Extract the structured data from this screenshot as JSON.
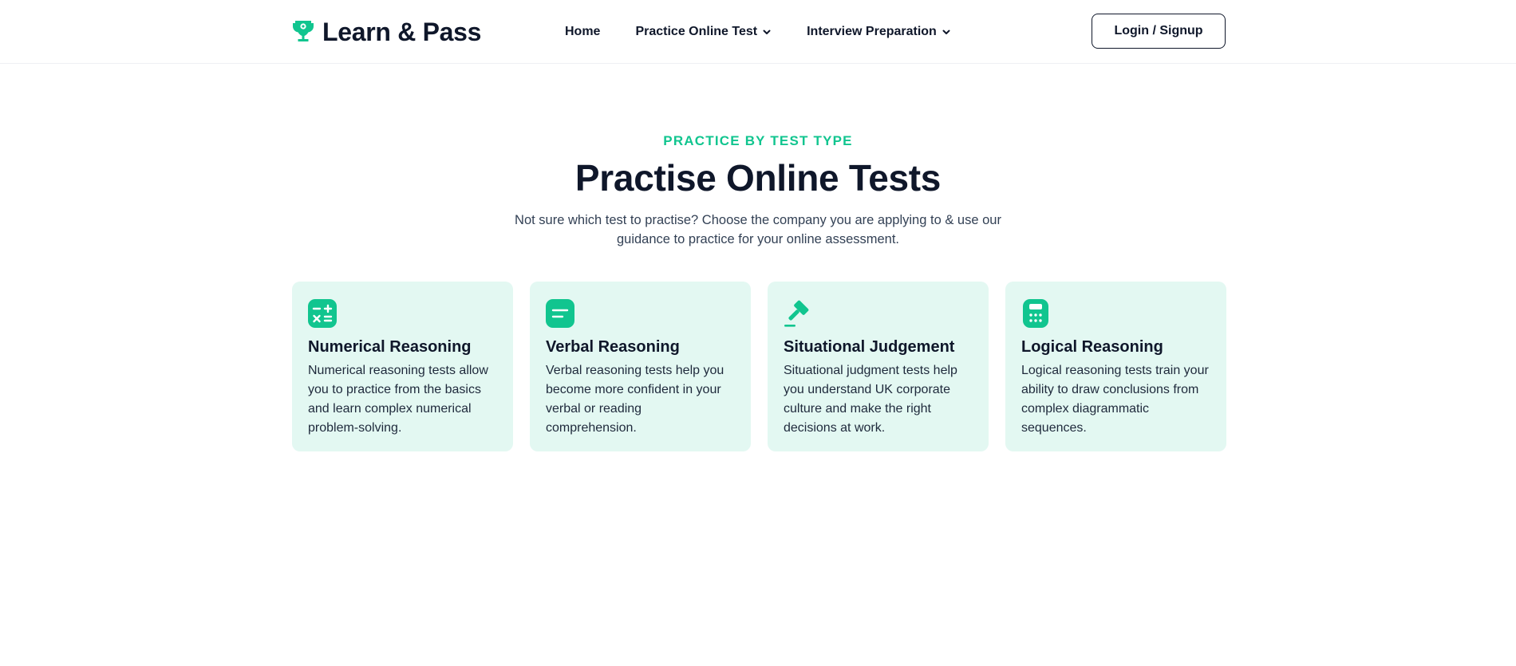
{
  "brand": {
    "name": "Learn & Pass",
    "logo_icon": "trophy-icon",
    "accent_color": "#11c58f"
  },
  "nav": {
    "items": [
      {
        "label": "Home",
        "has_dropdown": false
      },
      {
        "label": "Practice Online Test",
        "has_dropdown": true
      },
      {
        "label": "Interview Preparation",
        "has_dropdown": true
      }
    ],
    "login_label": "Login / Signup"
  },
  "hero": {
    "eyebrow": "PRACTICE BY TEST TYPE",
    "title": "Practise Online Tests",
    "subtitle": "Not sure which test to practise? Choose the company you are applying to & use our guidance to practice for your online assessment."
  },
  "cards": [
    {
      "icon": "calculator-operations-icon",
      "title": "Numerical Reasoning",
      "description": "Numerical reasoning tests allow you to practice from the basics and learn complex numerical problem-solving."
    },
    {
      "icon": "text-lines-icon",
      "title": "Verbal Reasoning",
      "description": "Verbal reasoning tests help you become more confident in your verbal or reading comprehension."
    },
    {
      "icon": "gavel-icon",
      "title": "Situational Judgement",
      "description": "Situational judgment tests help you understand UK corporate culture and make the right decisions at work."
    },
    {
      "icon": "calculator-icon",
      "title": "Logical Reasoning",
      "description": "Logical reasoning tests train your ability to draw conclusions from complex diagrammatic sequences."
    }
  ]
}
